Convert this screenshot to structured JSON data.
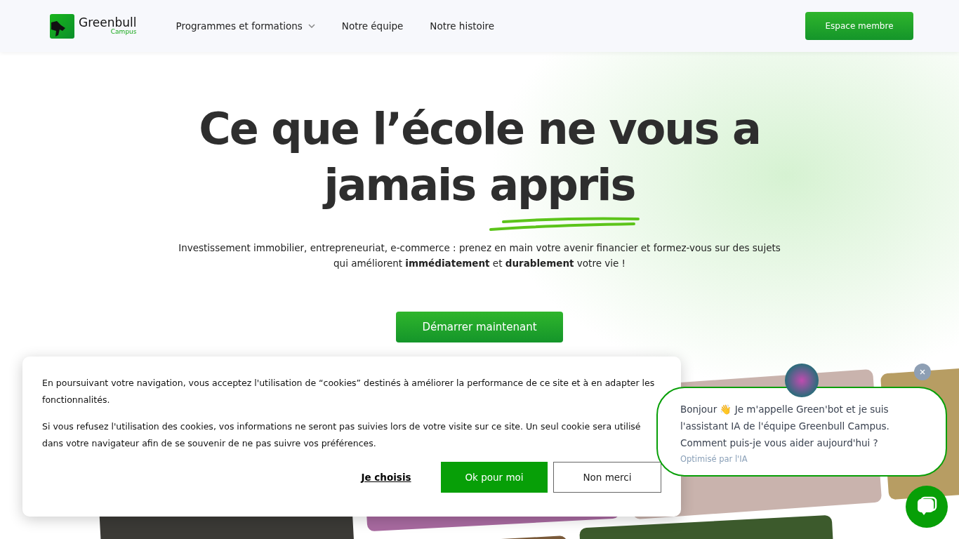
{
  "header": {
    "logo": {
      "name": "Greenbull",
      "sub": "Campus"
    },
    "nav": [
      {
        "label": "Programmes et formations",
        "dropdown": true
      },
      {
        "label": "Notre équipe",
        "dropdown": false
      },
      {
        "label": "Notre histoire",
        "dropdown": false
      }
    ],
    "member_button": "Espace membre"
  },
  "hero": {
    "title_line1": "Ce que l’école ne vous a",
    "title_line2": "jamais",
    "title_highlight": "appris",
    "subtitle": "Investissement immobilier, entrepreneuriat, e-commerce : prenez en main votre avenir financier et formez-vous sur des sujets qui améliorent **immédiatement** et **durablement** votre vie !",
    "cta": "Démarrer maintenant"
  },
  "cookie_banner": {
    "paragraphs": [
      "En poursuivant votre navigation, vous acceptez l'utilisation de “cookies” destinés à améliorer la performance de ce site et à en adapter les fonctionnalités.",
      "Si vous refusez l'utilisation des cookies, vos informations ne seront pas suivies lors de votre visite sur ce site. Un seul cookie sera utilisé dans votre navigateur afin de se souvenir de ne pas suivre vos préférences."
    ],
    "buttons": [
      {
        "label": "Je choisis",
        "kind": "link"
      },
      {
        "label": "Ok pour moi",
        "kind": "primary"
      },
      {
        "label": "Non merci",
        "kind": "outline"
      }
    ]
  },
  "chat": {
    "message": "Bonjour 👋 Je m'appelle Green'bot et je suis l'assistant IA de l'équipe Greenbull Campus. Comment puis-je vous aider aujourd'hui ?",
    "footer": "Optimisé par l'IA"
  }
}
